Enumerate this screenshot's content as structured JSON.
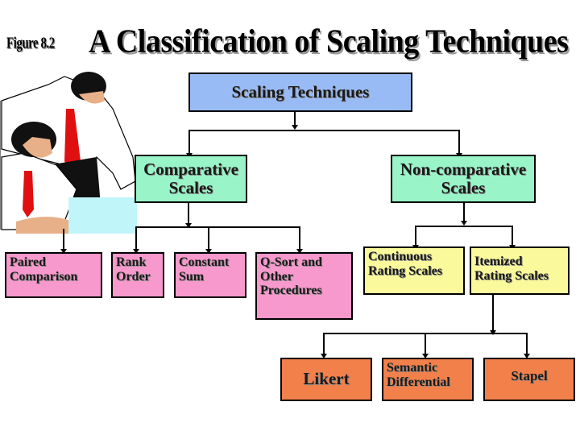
{
  "header": {
    "figure_label": "Figure 8.2",
    "title": "A Classification of Scaling Techniques"
  },
  "diagram": {
    "root": {
      "label": "Scaling Techniques",
      "color": "#99bbf5"
    },
    "comparative": {
      "line1": "Comparative",
      "line2": "Scales",
      "color": "#99f5c8"
    },
    "noncomparative": {
      "line1": "Non-comparative",
      "line2": "Scales",
      "color": "#99f5c8"
    },
    "comparative_children": [
      {
        "line1": "Paired",
        "line2": "Comparison",
        "line3": ""
      },
      {
        "line1": "Rank",
        "line2": "Order",
        "line3": ""
      },
      {
        "line1": "Constant",
        "line2": "Sum",
        "line3": ""
      },
      {
        "line1": "Q-Sort and",
        "line2": "Other",
        "line3": "Procedures"
      }
    ],
    "noncomparative_children": [
      {
        "line1": "Continuous",
        "line2": "Rating Scales"
      },
      {
        "line1": "Itemized",
        "line2": "Rating Scales"
      }
    ],
    "itemized_children": [
      {
        "line1": "Likert",
        "line2": ""
      },
      {
        "line1": "Semantic",
        "line2": "Differential"
      },
      {
        "line1": "Stapel",
        "line2": ""
      }
    ],
    "colors": {
      "comparative_leaf": "#f799cc",
      "noncomparative_leaf": "#fafa9c",
      "itemized_leaf": "#f2804a"
    }
  },
  "illustration": {
    "icon": "two-businessmen-clipart"
  }
}
